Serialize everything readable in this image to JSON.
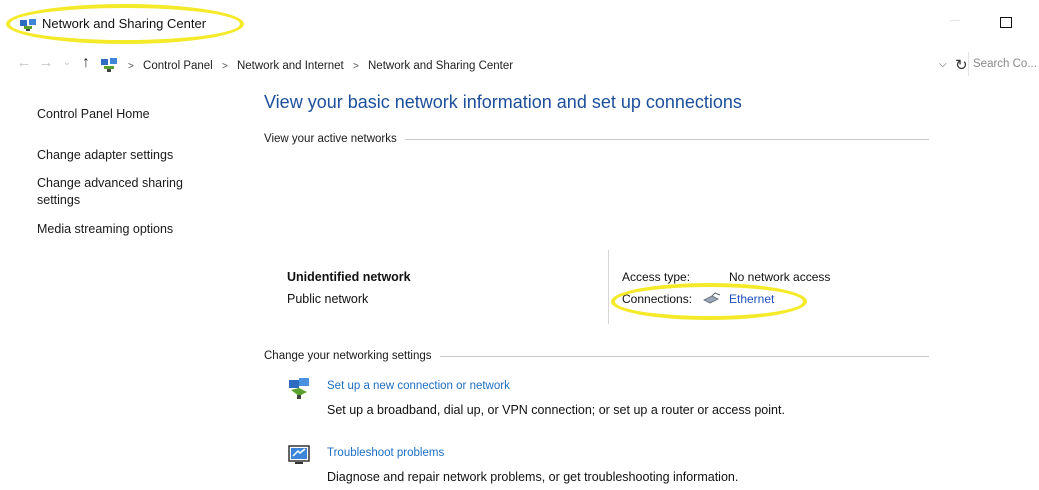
{
  "window": {
    "title": "Network and Sharing Center"
  },
  "addressbar": {
    "breadcrumbs": [
      "Control Panel",
      "Network and Internet",
      "Network and Sharing Center"
    ],
    "separator": ">",
    "search_placeholder": "Search Co..."
  },
  "sidebar": {
    "items": [
      {
        "label": "Control Panel Home"
      },
      {
        "label": "Change adapter settings"
      },
      {
        "label": "Change advanced sharing settings"
      },
      {
        "label": "Media streaming options"
      }
    ]
  },
  "main": {
    "title": "View your basic network information and set up connections",
    "active_networks_heading": "View your active networks",
    "network": {
      "name": "Unidentified network",
      "category": "Public network",
      "access_type_label": "Access type:",
      "access_type_value": "No network access",
      "connections_label": "Connections:",
      "connection_name": "Ethernet"
    },
    "settings_heading": "Change your networking settings",
    "tasks": [
      {
        "link": "Set up a new connection or network",
        "description": "Set up a broadband, dial up, or VPN connection; or set up a router or access point."
      },
      {
        "link": "Troubleshoot problems",
        "description": "Diagnose and repair network problems, or get troubleshooting information."
      }
    ]
  },
  "colors": {
    "title_blue": "#1c4f9b",
    "link_blue": "#1c6fc4",
    "highlight_yellow": "#f5ea2a"
  }
}
